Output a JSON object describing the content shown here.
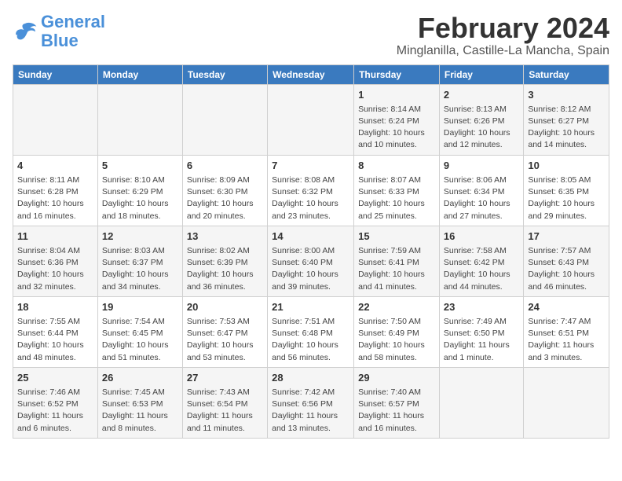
{
  "header": {
    "logo_line1": "General",
    "logo_line2": "Blue",
    "month": "February 2024",
    "location": "Minglanilla, Castille-La Mancha, Spain"
  },
  "days_of_week": [
    "Sunday",
    "Monday",
    "Tuesday",
    "Wednesday",
    "Thursday",
    "Friday",
    "Saturday"
  ],
  "weeks": [
    [
      {
        "day": "",
        "info": ""
      },
      {
        "day": "",
        "info": ""
      },
      {
        "day": "",
        "info": ""
      },
      {
        "day": "",
        "info": ""
      },
      {
        "day": "1",
        "info": "Sunrise: 8:14 AM\nSunset: 6:24 PM\nDaylight: 10 hours\nand 10 minutes."
      },
      {
        "day": "2",
        "info": "Sunrise: 8:13 AM\nSunset: 6:26 PM\nDaylight: 10 hours\nand 12 minutes."
      },
      {
        "day": "3",
        "info": "Sunrise: 8:12 AM\nSunset: 6:27 PM\nDaylight: 10 hours\nand 14 minutes."
      }
    ],
    [
      {
        "day": "4",
        "info": "Sunrise: 8:11 AM\nSunset: 6:28 PM\nDaylight: 10 hours\nand 16 minutes."
      },
      {
        "day": "5",
        "info": "Sunrise: 8:10 AM\nSunset: 6:29 PM\nDaylight: 10 hours\nand 18 minutes."
      },
      {
        "day": "6",
        "info": "Sunrise: 8:09 AM\nSunset: 6:30 PM\nDaylight: 10 hours\nand 20 minutes."
      },
      {
        "day": "7",
        "info": "Sunrise: 8:08 AM\nSunset: 6:32 PM\nDaylight: 10 hours\nand 23 minutes."
      },
      {
        "day": "8",
        "info": "Sunrise: 8:07 AM\nSunset: 6:33 PM\nDaylight: 10 hours\nand 25 minutes."
      },
      {
        "day": "9",
        "info": "Sunrise: 8:06 AM\nSunset: 6:34 PM\nDaylight: 10 hours\nand 27 minutes."
      },
      {
        "day": "10",
        "info": "Sunrise: 8:05 AM\nSunset: 6:35 PM\nDaylight: 10 hours\nand 29 minutes."
      }
    ],
    [
      {
        "day": "11",
        "info": "Sunrise: 8:04 AM\nSunset: 6:36 PM\nDaylight: 10 hours\nand 32 minutes."
      },
      {
        "day": "12",
        "info": "Sunrise: 8:03 AM\nSunset: 6:37 PM\nDaylight: 10 hours\nand 34 minutes."
      },
      {
        "day": "13",
        "info": "Sunrise: 8:02 AM\nSunset: 6:39 PM\nDaylight: 10 hours\nand 36 minutes."
      },
      {
        "day": "14",
        "info": "Sunrise: 8:00 AM\nSunset: 6:40 PM\nDaylight: 10 hours\nand 39 minutes."
      },
      {
        "day": "15",
        "info": "Sunrise: 7:59 AM\nSunset: 6:41 PM\nDaylight: 10 hours\nand 41 minutes."
      },
      {
        "day": "16",
        "info": "Sunrise: 7:58 AM\nSunset: 6:42 PM\nDaylight: 10 hours\nand 44 minutes."
      },
      {
        "day": "17",
        "info": "Sunrise: 7:57 AM\nSunset: 6:43 PM\nDaylight: 10 hours\nand 46 minutes."
      }
    ],
    [
      {
        "day": "18",
        "info": "Sunrise: 7:55 AM\nSunset: 6:44 PM\nDaylight: 10 hours\nand 48 minutes."
      },
      {
        "day": "19",
        "info": "Sunrise: 7:54 AM\nSunset: 6:45 PM\nDaylight: 10 hours\nand 51 minutes."
      },
      {
        "day": "20",
        "info": "Sunrise: 7:53 AM\nSunset: 6:47 PM\nDaylight: 10 hours\nand 53 minutes."
      },
      {
        "day": "21",
        "info": "Sunrise: 7:51 AM\nSunset: 6:48 PM\nDaylight: 10 hours\nand 56 minutes."
      },
      {
        "day": "22",
        "info": "Sunrise: 7:50 AM\nSunset: 6:49 PM\nDaylight: 10 hours\nand 58 minutes."
      },
      {
        "day": "23",
        "info": "Sunrise: 7:49 AM\nSunset: 6:50 PM\nDaylight: 11 hours\nand 1 minute."
      },
      {
        "day": "24",
        "info": "Sunrise: 7:47 AM\nSunset: 6:51 PM\nDaylight: 11 hours\nand 3 minutes."
      }
    ],
    [
      {
        "day": "25",
        "info": "Sunrise: 7:46 AM\nSunset: 6:52 PM\nDaylight: 11 hours\nand 6 minutes."
      },
      {
        "day": "26",
        "info": "Sunrise: 7:45 AM\nSunset: 6:53 PM\nDaylight: 11 hours\nand 8 minutes."
      },
      {
        "day": "27",
        "info": "Sunrise: 7:43 AM\nSunset: 6:54 PM\nDaylight: 11 hours\nand 11 minutes."
      },
      {
        "day": "28",
        "info": "Sunrise: 7:42 AM\nSunset: 6:56 PM\nDaylight: 11 hours\nand 13 minutes."
      },
      {
        "day": "29",
        "info": "Sunrise: 7:40 AM\nSunset: 6:57 PM\nDaylight: 11 hours\nand 16 minutes."
      },
      {
        "day": "",
        "info": ""
      },
      {
        "day": "",
        "info": ""
      }
    ]
  ]
}
